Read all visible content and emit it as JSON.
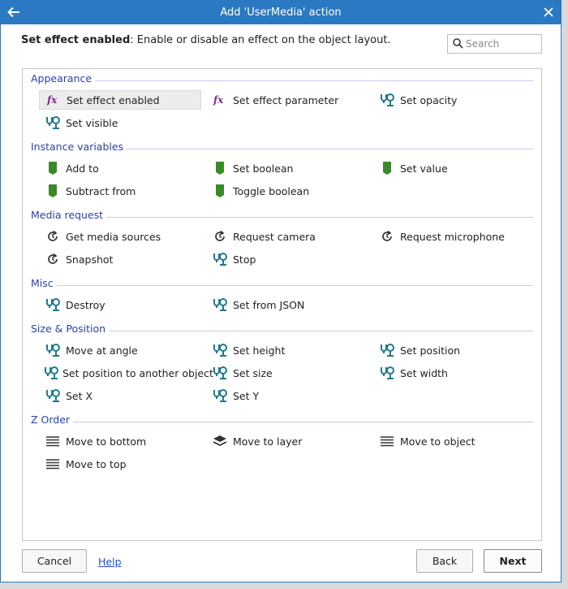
{
  "window": {
    "title": "Add 'UserMedia' action"
  },
  "description": {
    "name": "Set effect enabled",
    "text": ": Enable or disable an effect on the object layout."
  },
  "search": {
    "placeholder": "Search",
    "value": ""
  },
  "categories": [
    {
      "title": "Appearance",
      "items": [
        {
          "label": "Set effect enabled",
          "icon": "fx-icon",
          "selected": true
        },
        {
          "label": "Set effect parameter",
          "icon": "fx-icon"
        },
        {
          "label": "Set opacity",
          "icon": "object-icon"
        },
        {
          "label": "Set visible",
          "icon": "object-icon"
        }
      ]
    },
    {
      "title": "Instance variables",
      "items": [
        {
          "label": "Add to",
          "icon": "variable-icon"
        },
        {
          "label": "Set boolean",
          "icon": "variable-icon"
        },
        {
          "label": "Set value",
          "icon": "variable-icon"
        },
        {
          "label": "Subtract from",
          "icon": "variable-icon"
        },
        {
          "label": "Toggle boolean",
          "icon": "variable-icon"
        }
      ]
    },
    {
      "title": "Media request",
      "items": [
        {
          "label": "Get media sources",
          "icon": "async-icon"
        },
        {
          "label": "Request camera",
          "icon": "async-icon"
        },
        {
          "label": "Request microphone",
          "icon": "async-icon"
        },
        {
          "label": "Snapshot",
          "icon": "async-icon"
        },
        {
          "label": "Stop",
          "icon": "object-icon"
        }
      ]
    },
    {
      "title": "Misc",
      "items": [
        {
          "label": "Destroy",
          "icon": "object-icon"
        },
        {
          "label": "Set from JSON",
          "icon": "object-icon"
        }
      ]
    },
    {
      "title": "Size & Position",
      "items": [
        {
          "label": "Move at angle",
          "icon": "object-icon"
        },
        {
          "label": "Set height",
          "icon": "object-icon"
        },
        {
          "label": "Set position",
          "icon": "object-icon"
        },
        {
          "label": "Set position to another object",
          "icon": "object-icon"
        },
        {
          "label": "Set size",
          "icon": "object-icon"
        },
        {
          "label": "Set width",
          "icon": "object-icon"
        },
        {
          "label": "Set X",
          "icon": "object-icon"
        },
        {
          "label": "Set Y",
          "icon": "object-icon"
        }
      ]
    },
    {
      "title": "Z Order",
      "items": [
        {
          "label": "Move to bottom",
          "icon": "stack-icon"
        },
        {
          "label": "Move to layer",
          "icon": "layers-icon"
        },
        {
          "label": "Move to object",
          "icon": "stack-icon"
        },
        {
          "label": "Move to top",
          "icon": "stack-icon"
        }
      ]
    }
  ],
  "footer": {
    "cancel_label": "Cancel",
    "help_label": "Help",
    "back_label": "Back",
    "next_label": "Next"
  },
  "colors": {
    "titlebar": "#2b79c2",
    "category_title": "#2a3fb0",
    "fx_icon": "#7a2a8c",
    "object_icon": "#1f7a8c",
    "variable_icon": "#3a8a2a"
  }
}
